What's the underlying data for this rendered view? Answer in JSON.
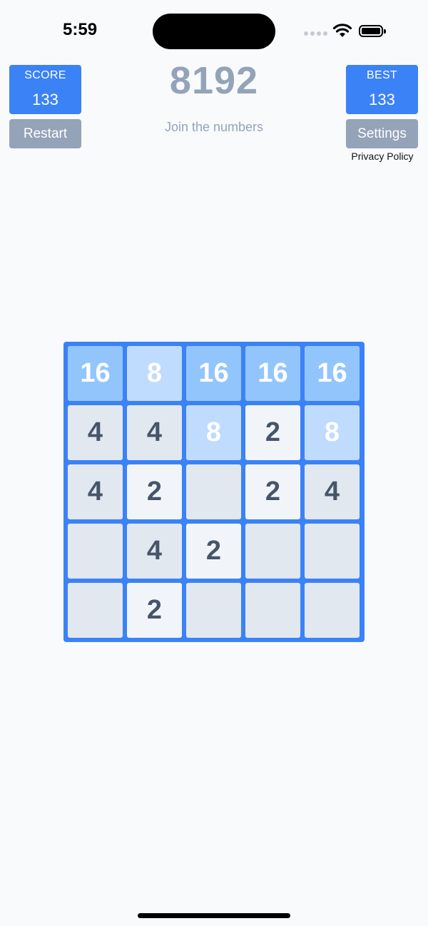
{
  "status_bar": {
    "time": "5:59"
  },
  "score": {
    "label": "SCORE",
    "value": "133"
  },
  "best": {
    "label": "BEST",
    "value": "133"
  },
  "title": "8192",
  "subtitle": "Join the numbers",
  "buttons": {
    "restart": "Restart",
    "settings": "Settings",
    "privacy": "Privacy Policy"
  },
  "colors": {
    "accent": "#3b82f6",
    "muted": "#94a3b8"
  },
  "board": {
    "rows": [
      [
        "16",
        "8",
        "16",
        "16",
        "16"
      ],
      [
        "4",
        "4",
        "8",
        "2",
        "8"
      ],
      [
        "4",
        "2",
        "",
        "2",
        "4"
      ],
      [
        "",
        "4",
        "2",
        "",
        ""
      ],
      [
        "",
        "2",
        "",
        "",
        ""
      ]
    ]
  }
}
